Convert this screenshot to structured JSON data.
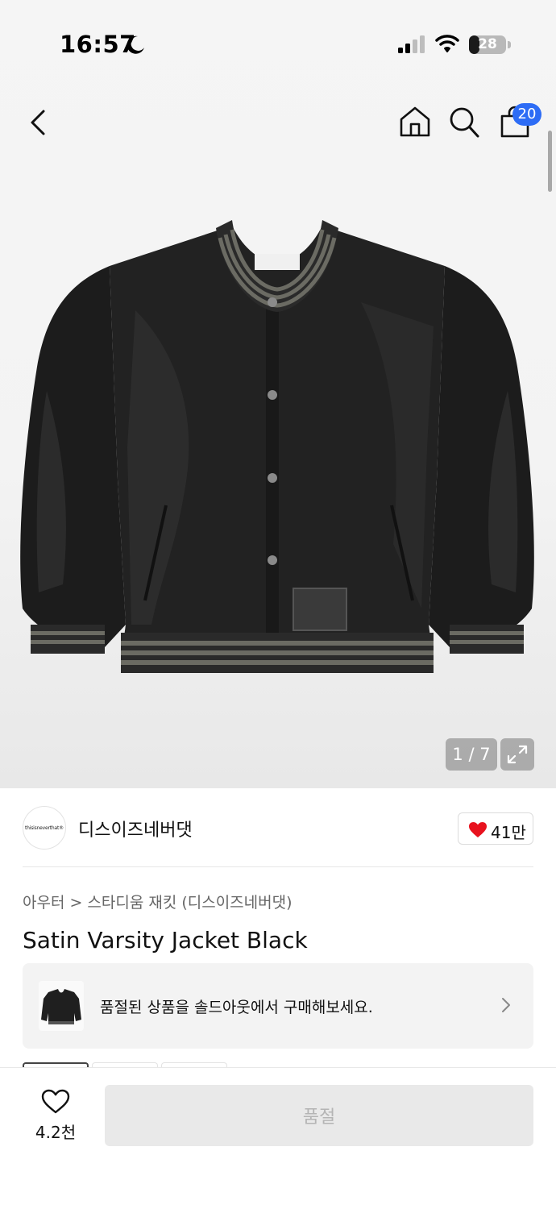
{
  "status_bar": {
    "time": "16:57",
    "battery_level": "28",
    "battery_fraction": 0.28
  },
  "nav": {
    "cart_badge": "20"
  },
  "gallery": {
    "counter": "1 / 7"
  },
  "brand": {
    "logo_text": "thisisneverthat®",
    "name": "디스이즈네버댓",
    "likes": "41만"
  },
  "breadcrumb": {
    "category": "아우터",
    "separator": ">",
    "subcategory": "스타디움 재킷 (디스이즈네버댓)"
  },
  "product": {
    "title": "Satin Varsity Jacket Black"
  },
  "soldout_banner": {
    "text": "품절된 상품을 솔드아웃에서 구매해보세요."
  },
  "bottom_bar": {
    "wish_count": "4.2천",
    "buy_label": "품절"
  },
  "colors": {
    "badge": "#2d6cf5",
    "heart": "#e8121e",
    "buy_disabled_bg": "#e9e9e9",
    "buy_disabled_text": "#b4b4b4"
  }
}
